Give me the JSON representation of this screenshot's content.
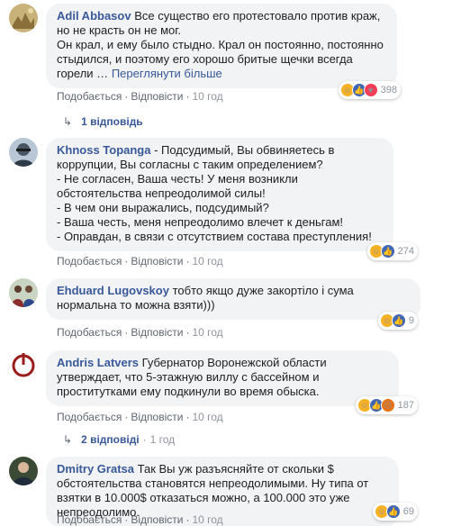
{
  "comments": [
    {
      "author": "Adil Abbasov",
      "text": "Все существо его протестовало против краж, но не красть он не мог.\nОн крал, и ему было стыдно. Крал он постоянно, постоянно стыдился, и поэтому его хорошо бритые щечки всегда горели …",
      "see_more": "Переглянути більше",
      "like": "Подобається",
      "reply": "Відповісти",
      "time": "10 год",
      "reaction_icons": [
        "haha-icon",
        "like-icon",
        "love-icon"
      ],
      "reaction_count": "398"
    },
    {
      "author": "Khnoss Topanga",
      "text": "- Подсудимый, Вы обвиняетесь в коррупции, Вы согласны с таким определением?\n- Не согласен, Ваша честь! У меня возникли обстоятельства непреодолимой силы!\n- В чем они выражались, подсудимый?\n- Ваша честь, меня непреодолимо влечет к деньгам!\n- Оправдан, в связи с отсутствием состава преступления!",
      "like": "Подобається",
      "reply": "Відповісти",
      "time": "10 год",
      "reaction_icons": [
        "haha-icon",
        "like-icon"
      ],
      "reaction_count": "274"
    },
    {
      "author": "Ehduard Lugovskoy",
      "text": "тобто якщо дуже закортіло і сума нормальна то можна взяти)))",
      "like": "Подобається",
      "reply": "Відповісти",
      "time": "10 год",
      "reaction_icons": [
        "haha-icon",
        "like-icon"
      ],
      "reaction_count": "9"
    },
    {
      "author": "Andris Latvers",
      "text": "Губернатор Воронежской области утверждает, что 5-этажную виллу с бассейном и проститутками ему подкинули во время обыска.",
      "like": "Подобається",
      "reply": "Відповісти",
      "time": "10 год",
      "reaction_icons": [
        "haha-icon",
        "like-icon",
        "angry-icon"
      ],
      "reaction_count": "187"
    },
    {
      "author": "Dmitry Gratsa",
      "text": "Так Вы уж разъясняйте от скольки $ обстоятельства становятся непреодолимыми. Ну типа от взятки в 10.000$ отказаться можно, а 100.000 это уже непреодолимо.",
      "like": "Подобається",
      "reply": "Відповісти",
      "time": "10 год",
      "reaction_icons": [
        "haha-icon",
        "like-icon"
      ],
      "reaction_count": "69"
    }
  ],
  "reply_threads": [
    {
      "label": "1 відповідь"
    },
    {
      "label": "2 відповіді",
      "time": "1 год"
    }
  ],
  "colors": {
    "link": "#385898",
    "bubble": "#f2f3f5",
    "meta": "#606770"
  }
}
